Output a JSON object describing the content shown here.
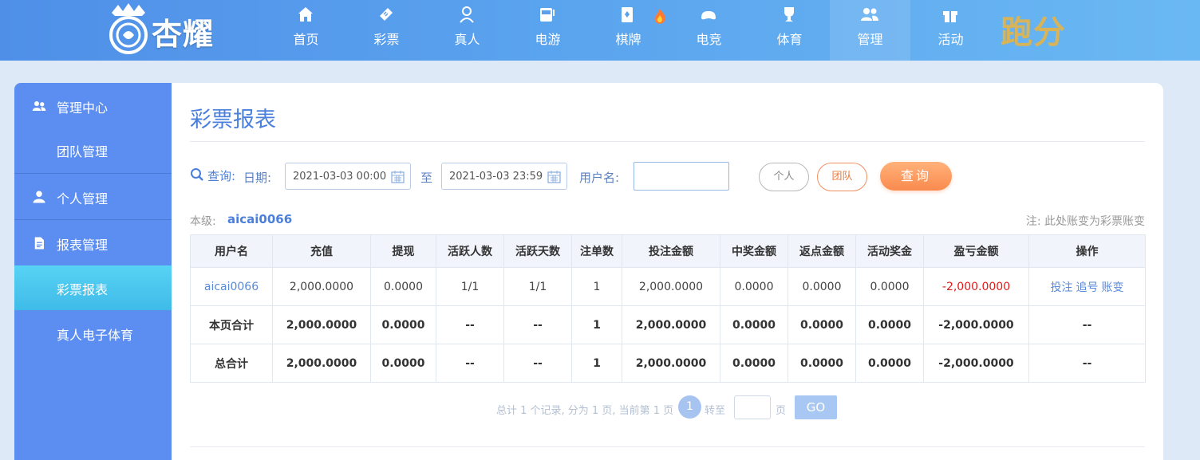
{
  "brand": {
    "logo_text": "杏耀",
    "promo_text": "跑分"
  },
  "nav": [
    {
      "label": "首页",
      "icon": "home-icon"
    },
    {
      "label": "彩票",
      "icon": "ticket-icon"
    },
    {
      "label": "真人",
      "icon": "dealer-icon"
    },
    {
      "label": "电游",
      "icon": "slot-machine-icon"
    },
    {
      "label": "棋牌",
      "icon": "playing-card-icon"
    },
    {
      "label": "电竞",
      "icon": "gamepad-icon"
    },
    {
      "label": "体育",
      "icon": "trophy-icon"
    },
    {
      "label": "管理",
      "icon": "users-icon",
      "active": true
    },
    {
      "label": "活动",
      "icon": "gift-icon"
    }
  ],
  "sidebar": {
    "sections": [
      {
        "label": "管理中心",
        "icon": "users-icon",
        "items": [
          "团队管理"
        ]
      },
      {
        "label": "个人管理",
        "icon": "user-icon",
        "items": []
      },
      {
        "label": "报表管理",
        "icon": "document-icon",
        "items": [
          "彩票报表",
          "真人电子体育"
        ]
      }
    ],
    "active_item": "彩票报表"
  },
  "page": {
    "title": "彩票报表",
    "query_label": "查询:",
    "date_label": "日期:",
    "date_from": "2021-03-03 00:00",
    "to_label": "至",
    "date_to": "2021-03-03 23:59",
    "username_label": "用户名:",
    "username_value": "",
    "btn_personal": "个人",
    "btn_team": "团队",
    "btn_query": "查询",
    "level_label": "本级:",
    "level_value": "aicai0066",
    "note": "注: 此处账变为彩票账变"
  },
  "table": {
    "columns": [
      "用户名",
      "充值",
      "提现",
      "活跃人数",
      "活跃天数",
      "注单数",
      "投注金额",
      "中奖金额",
      "返点金额",
      "活动奖金",
      "盈亏金额",
      "操作"
    ],
    "rows": [
      {
        "cells": [
          "aicai0066",
          "2,000.0000",
          "0.0000",
          "1/1",
          "1/1",
          "1",
          "2,000.0000",
          "0.0000",
          "0.0000",
          "0.0000",
          "-2,000.0000"
        ],
        "ops": [
          "投注",
          "追号",
          "账变"
        ]
      },
      {
        "cells": [
          "本页合计",
          "2,000.0000",
          "0.0000",
          "--",
          "--",
          "1",
          "2,000.0000",
          "0.0000",
          "0.0000",
          "0.0000",
          "-2,000.0000"
        ],
        "op_text": "--"
      },
      {
        "cells": [
          "总合计",
          "2,000.0000",
          "0.0000",
          "--",
          "--",
          "1",
          "2,000.0000",
          "0.0000",
          "0.0000",
          "0.0000",
          "-2,000.0000"
        ],
        "op_text": "--"
      }
    ]
  },
  "pager": {
    "summary": "总计 1 个记录, 分为 1 页, 当前第 1 页",
    "current": "1",
    "goto_label": "转至",
    "page_label": "页",
    "go_label": "GO"
  }
}
